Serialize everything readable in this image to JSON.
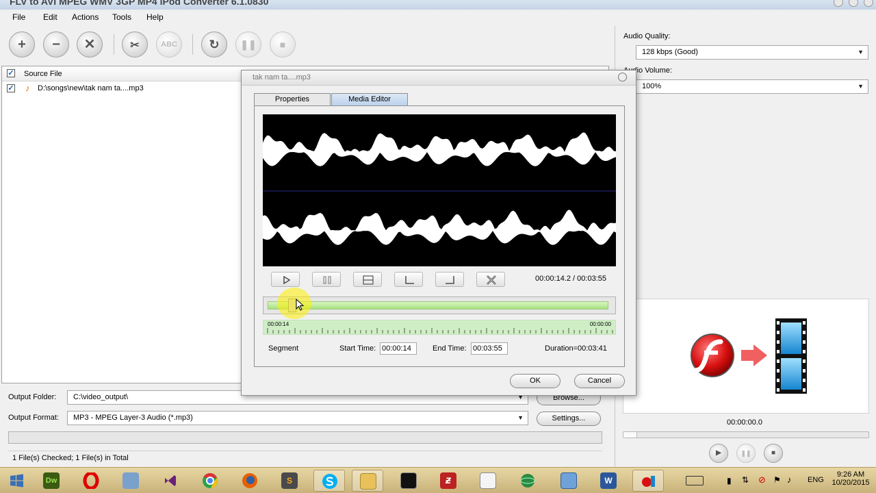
{
  "window": {
    "title": "FLV to AVI MPEG WMV 3GP MP4 iPod Converter 6.1.0830"
  },
  "menu": [
    "File",
    "Edit",
    "Actions",
    "Tools",
    "Help"
  ],
  "toolbar": {
    "abc_label": "ABC",
    "icons": [
      "add-icon",
      "remove-icon",
      "clear-icon",
      "clip-icon",
      "rename-icon",
      "convert-icon",
      "pause-icon",
      "stop-icon"
    ]
  },
  "file_list": {
    "header": "Source File",
    "rows": [
      {
        "checked": true,
        "name": "D:\\songs\\new\\tak nam ta....mp3"
      }
    ]
  },
  "right_panel": {
    "audio_quality_label": "Audio Quality:",
    "audio_quality_value": "128 kbps (Good)",
    "audio_volume_label": "Audio Volume:",
    "audio_volume_value": "100%",
    "preview_time": "00:00:00.0"
  },
  "bottom": {
    "output_folder_label": "Output Folder:",
    "output_folder_value": "C:\\video_output\\",
    "browse_label": "Browse...",
    "output_format_label": "Output Format:",
    "output_format_value": "MP3 - MPEG Layer-3 Audio (*.mp3)",
    "settings_label": "Settings...",
    "status": "1 File(s) Checked; 1 File(s) in Total"
  },
  "dialog": {
    "title": "tak nam ta....mp3",
    "tabs": [
      "Properties",
      "Media Editor"
    ],
    "active_tab": 1,
    "time_display": "00:00:14.2 / 00:03:55",
    "playhead_fraction": 0.06,
    "ruler_start": "00:00:14",
    "ruler_end": "00:00:00",
    "segment_label": "Segment",
    "start_time_label": "Start Time:",
    "start_time_value": "00:00:14",
    "end_time_label": "End Time:",
    "end_time_value": "00:03:55",
    "duration_text": "Duration=00:03:41",
    "ok_label": "OK",
    "cancel_label": "Cancel"
  },
  "taskbar": {
    "apps": [
      "start",
      "dreamweaver",
      "opera",
      "network",
      "visual-studio",
      "chrome",
      "firefox",
      "sublime",
      "skype",
      "explorer",
      "cmd",
      "filezilla",
      "sheet",
      "globe",
      "desktop",
      "word",
      "converter"
    ],
    "dw_label": "Dw",
    "s_label": "S",
    "lang": "ENG",
    "time": "9:26 AM",
    "date": "10/20/2015"
  }
}
